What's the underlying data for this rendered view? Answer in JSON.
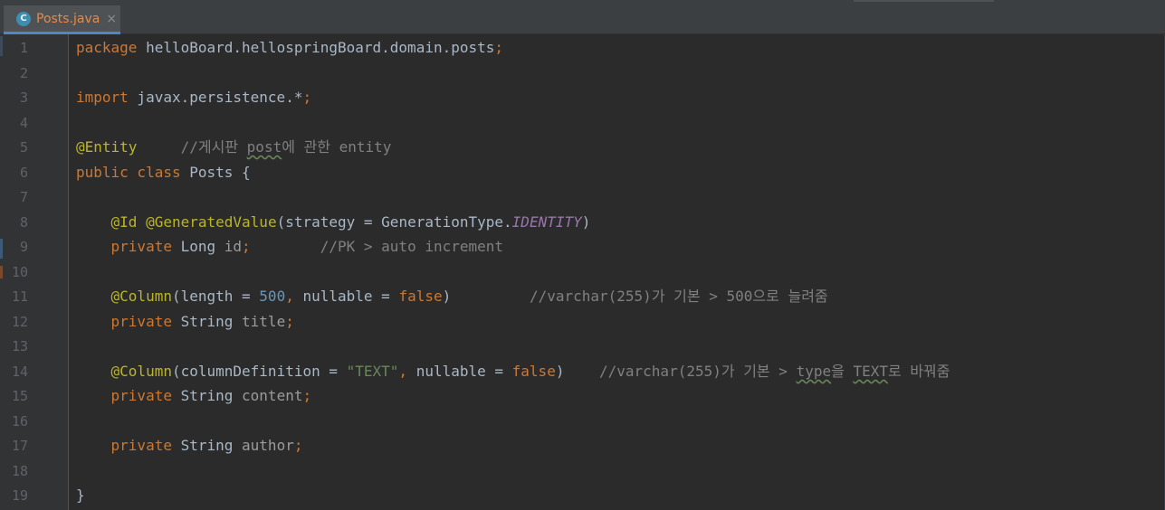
{
  "tab": {
    "icon_letter": "C",
    "title": "Posts.java",
    "close_glyph": "×"
  },
  "editor": {
    "line_numbers": [
      "1",
      "2",
      "3",
      "4",
      "5",
      "6",
      "7",
      "8",
      "9",
      "10",
      "11",
      "12",
      "13",
      "14",
      "15",
      "16",
      "17",
      "18",
      "19"
    ],
    "lines": {
      "l1": {
        "kw": "package",
        "pkg": " helloBoard.hellospringBoard.domain.posts",
        "semi": ";"
      },
      "l3": {
        "kw": "import",
        "pkg": " javax.persistence.*",
        "semi": ";"
      },
      "l5": {
        "ann": "@Entity",
        "gap": "     ",
        "c1": "//게시판 ",
        "c2": "post",
        "c3": "에 관한 entity"
      },
      "l6": {
        "kw": "public class",
        "rest": " Posts {"
      },
      "l8": {
        "indent": "    ",
        "ann1": "@Id",
        "sp": " ",
        "ann2": "@GeneratedValue",
        "p1": "(strategy = GenerationType.",
        "field": "IDENTITY",
        "p2": ")"
      },
      "l9": {
        "indent": "    ",
        "kw": "private",
        "type": " Long ",
        "var": "id",
        "semi": ";",
        "gap": "        ",
        "comment": "//PK > auto increment"
      },
      "l11": {
        "indent": "    ",
        "ann": "@Column",
        "p1": "(length = ",
        "num": "500",
        "comma": ",",
        "p2": " nullable = ",
        "bool": "false",
        "p3": ")",
        "gap": "         ",
        "comment": "//varchar(255)가 기본 > 500으로 늘려줌"
      },
      "l12": {
        "indent": "    ",
        "kw": "private",
        "type": " String ",
        "var": "title",
        "semi": ";"
      },
      "l14": {
        "indent": "    ",
        "ann": "@Column",
        "p1": "(columnDefinition = ",
        "str": "\"TEXT\"",
        "comma": ",",
        "p2": " nullable = ",
        "bool": "false",
        "p3": ")",
        "gap": "    ",
        "c1": "//varchar(255)가 기본 > ",
        "c2": "type",
        "c3": "을 ",
        "c4": "TEXT",
        "c5": "로 바꿔줌"
      },
      "l15": {
        "indent": "    ",
        "kw": "private",
        "type": " String ",
        "var": "content",
        "semi": ";"
      },
      "l17": {
        "indent": "    ",
        "kw": "private",
        "type": " String ",
        "var": "author",
        "semi": ";"
      },
      "l19": {
        "text": "}"
      }
    }
  },
  "colors": {
    "keyword": "#cc7832",
    "annotation": "#bbb529",
    "comment": "#808080",
    "number": "#6897bb",
    "string": "#6a8759",
    "static_field": "#9876aa",
    "default_text": "#a9b7c6",
    "tab_accent": "#4a88c7",
    "tab_label": "#e38b4d"
  }
}
